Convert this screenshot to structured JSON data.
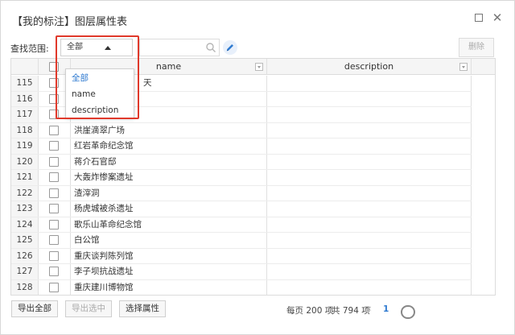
{
  "window": {
    "title": "【我的标注】图层属性表",
    "maximize_icon": "maximize-icon",
    "close_label": "✕"
  },
  "toolbar": {
    "scope_label": "查找范围:",
    "scope_value": "全部",
    "search_value": "",
    "delete_label": "删除"
  },
  "dropdown": {
    "options": [
      "全部",
      "name",
      "description"
    ],
    "selected_index": 0
  },
  "table": {
    "columns": [
      "name",
      "description"
    ],
    "rows": [
      {
        "num": "115",
        "name": "天",
        "description": ""
      },
      {
        "num": "116",
        "name": "",
        "description": ""
      },
      {
        "num": "117",
        "name": "",
        "description": ""
      },
      {
        "num": "118",
        "name": "洪崖滴翠广场",
        "description": ""
      },
      {
        "num": "119",
        "name": "红岩革命纪念馆",
        "description": ""
      },
      {
        "num": "120",
        "name": "蒋介石官邸",
        "description": ""
      },
      {
        "num": "121",
        "name": "大轰炸惨案遗址",
        "description": ""
      },
      {
        "num": "122",
        "name": "渣滓洞",
        "description": ""
      },
      {
        "num": "123",
        "name": "杨虎城被杀遗址",
        "description": ""
      },
      {
        "num": "124",
        "name": "歌乐山革命纪念馆",
        "description": ""
      },
      {
        "num": "125",
        "name": "白公馆",
        "description": ""
      },
      {
        "num": "126",
        "name": "重庆谈判陈列馆",
        "description": ""
      },
      {
        "num": "127",
        "name": "李子坝抗战遗址",
        "description": ""
      },
      {
        "num": "128",
        "name": "重庆建川博物馆",
        "description": ""
      }
    ]
  },
  "footer": {
    "export_all": "导出全部",
    "export_selected": "导出选中",
    "select_attrs": "选择属性",
    "page_size": "每页 200 项",
    "total": "共 794 项",
    "prev": "‹",
    "current_page": "1"
  },
  "colors": {
    "accent": "#2f7ad0",
    "highlight": "#e0392b"
  }
}
